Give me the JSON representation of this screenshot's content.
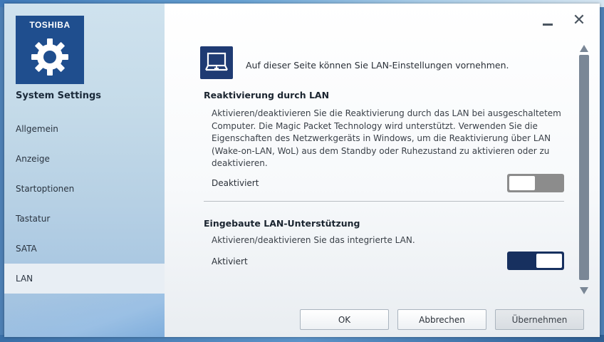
{
  "sidebar": {
    "brand": "TOSHIBA",
    "app_title": "System Settings",
    "items": [
      {
        "label": "Allgemein"
      },
      {
        "label": "Anzeige"
      },
      {
        "label": "Startoptionen"
      },
      {
        "label": "Tastatur"
      },
      {
        "label": "SATA"
      },
      {
        "label": "LAN"
      }
    ],
    "active_item": "LAN"
  },
  "window_controls": {
    "minimize_icon": "minimize-icon",
    "close_symbol": "✕"
  },
  "main": {
    "page_icon": "lan-computer-icon",
    "intro": "Auf dieser Seite können Sie LAN-Einstellungen vornehmen.",
    "sections": [
      {
        "title": "Reaktivierung durch LAN",
        "description": "Aktivieren/deaktivieren Sie die Reaktivierung durch das LAN bei ausgeschaltetem Computer. Die Magic Packet Technology wird unterstützt. Verwenden Sie die Eigenschaften des Netzwerkgeräts in Windows, um die Reaktivierung über LAN (Wake-on-LAN, WoL) aus dem Standby oder Ruhezustand zu aktivieren oder zu deaktivieren.",
        "state_label": "Deaktiviert",
        "enabled": false
      },
      {
        "title": "Eingebaute LAN-Unterstützung",
        "description": "Aktivieren/deaktivieren Sie das integrierte LAN.",
        "state_label": "Aktiviert",
        "enabled": true
      }
    ]
  },
  "buttons": {
    "ok": "OK",
    "cancel": "Abbrechen",
    "apply": "Übernehmen"
  },
  "colors": {
    "brand_blue": "#1f4e8e",
    "toggle_on": "#17305f",
    "toggle_off": "#8c8c8c"
  }
}
